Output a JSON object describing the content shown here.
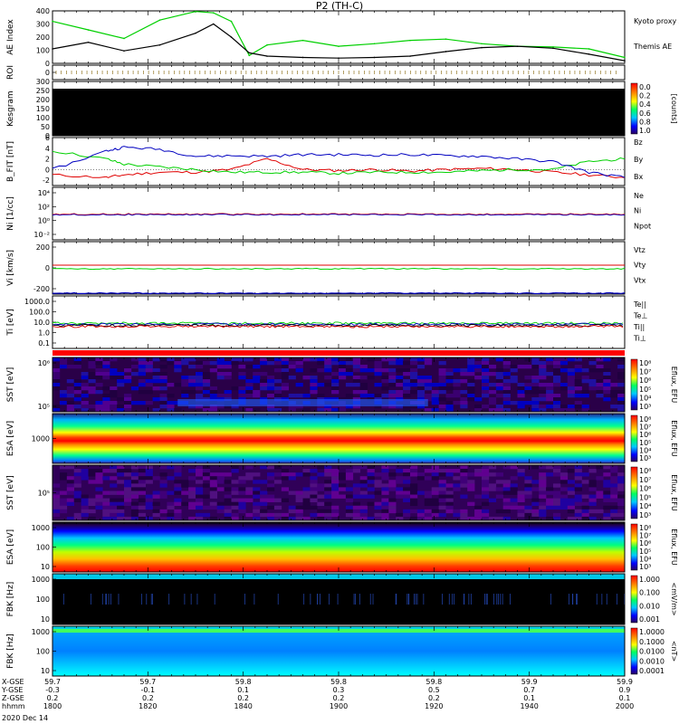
{
  "title": "P2 (TH-C)",
  "colors": {
    "green": "#00d000",
    "red": "#e00000",
    "blue": "#0000c0",
    "black": "#000000",
    "magenta": "#c000c0",
    "cyan": "#00c8c8"
  },
  "time_axis": {
    "tick_values": [
      "1800",
      "1820",
      "1840",
      "1900",
      "1920",
      "1940",
      "2000"
    ],
    "rows": [
      {
        "label": "X-GSE",
        "values": [
          "59.7",
          "59.7",
          "59.8",
          "59.8",
          "59.8",
          "59.9",
          "59.9"
        ]
      },
      {
        "label": "Y-GSE",
        "values": [
          "-0.3",
          "-0.1",
          "0.1",
          "0.3",
          "0.5",
          "0.7",
          "0.9"
        ]
      },
      {
        "label": "Z-GSE",
        "values": [
          "0.2",
          "0.2",
          "0.2",
          "0.2",
          "0.2",
          "0.1",
          "0.1"
        ]
      },
      {
        "label": "hhmm",
        "values": [
          "1800",
          "1820",
          "1840",
          "1900",
          "1920",
          "1940",
          "2000"
        ]
      }
    ],
    "date": "2020 Dec 14"
  },
  "chart_data": [
    {
      "type": "line",
      "ylabel": "AE Index",
      "ylim": [
        0,
        400
      ],
      "ytick_labels": [
        "0",
        "100",
        "200",
        "300",
        "400"
      ],
      "x": [
        1800,
        1810,
        1820,
        1830,
        1840,
        1845,
        1850,
        1855,
        1860,
        1870,
        1880,
        1890,
        1900,
        1910,
        1920,
        1930,
        1940,
        1950,
        1960
      ],
      "series": [
        {
          "name": "Kyoto proxy AE",
          "color_key": "green",
          "values": [
            320,
            255,
            190,
            330,
            395,
            385,
            320,
            60,
            140,
            175,
            130,
            150,
            175,
            185,
            150,
            130,
            125,
            110,
            45
          ]
        },
        {
          "name": "Themis AE",
          "color_key": "black",
          "values": [
            110,
            160,
            95,
            140,
            230,
            300,
            200,
            80,
            55,
            45,
            40,
            45,
            55,
            90,
            120,
            130,
            115,
            70,
            20
          ]
        }
      ]
    },
    {
      "type": "line",
      "ylabel": "ROI",
      "ytick_labels": [
        "0"
      ]
    },
    {
      "type": "heatmap",
      "ylabel": "Kesgram",
      "ylim": [
        0,
        300
      ],
      "ytick_labels": [
        "0",
        "50",
        "100",
        "150",
        "200",
        "250",
        "300"
      ],
      "colorbar": {
        "label": "[counts]",
        "tick_labels": [
          "0.0",
          "0.2",
          "0.4",
          "0.6",
          "0.8",
          "1.0"
        ]
      }
    },
    {
      "type": "line",
      "ylabel": "B_FIT [nT]",
      "ylim": [
        -3,
        6
      ],
      "ytick_labels": [
        "6",
        "4",
        "2",
        "0",
        "-2"
      ],
      "x": [
        1800,
        1815,
        1820,
        1830,
        1840,
        1850,
        1860,
        1870,
        1880,
        1890,
        1900,
        1910,
        1920,
        1930,
        1940,
        1950,
        1960
      ],
      "series": [
        {
          "name": "Bz",
          "color_key": "red",
          "values": [
            -1.0,
            -1.5,
            -1.0,
            -0.5,
            -0.5,
            0.0,
            2.0,
            0.0,
            -0.2,
            0.0,
            -0.3,
            0.0,
            0.2,
            0.0,
            -0.5,
            -1.0,
            -1.5
          ]
        },
        {
          "name": "By",
          "color_key": "green",
          "values": [
            3.5,
            2.0,
            1.0,
            0.5,
            0.0,
            -0.5,
            -0.5,
            -0.5,
            -0.7,
            -0.5,
            -0.5,
            -0.5,
            -0.2,
            0.0,
            0.0,
            1.5,
            2.0
          ]
        },
        {
          "name": "Bx",
          "color_key": "blue",
          "values": [
            0.0,
            3.5,
            4.2,
            3.8,
            2.5,
            2.6,
            2.5,
            2.8,
            2.8,
            2.7,
            2.8,
            2.6,
            2.5,
            2.0,
            1.5,
            -0.5,
            -1.5
          ]
        }
      ]
    },
    {
      "type": "line",
      "ylabel": "Ni [1/cc]",
      "ytick_labels": [
        "10⁴",
        "10²",
        "10⁰",
        "10⁻²"
      ],
      "series": [
        {
          "name": "Ne",
          "color_key": "red"
        },
        {
          "name": "Ni",
          "color_key": "black"
        },
        {
          "name": "Npot",
          "color_key": "blue"
        }
      ]
    },
    {
      "type": "line",
      "ylabel": "Vi [km/s]",
      "ytick_labels": [
        "200",
        "0",
        "-200"
      ],
      "series": [
        {
          "name": "Vtz",
          "color_key": "red"
        },
        {
          "name": "Vty",
          "color_key": "green"
        },
        {
          "name": "Vtx",
          "color_key": "blue"
        }
      ]
    },
    {
      "type": "line",
      "ylabel": "Ti [eV]",
      "ytick_labels": [
        "1000.0",
        "100.0",
        "10.0",
        "1.0",
        "0.1"
      ],
      "series": [
        {
          "name": "Te||",
          "color_key": "black"
        },
        {
          "name": "Te⊥",
          "color_key": "red"
        },
        {
          "name": "Ti||",
          "color_key": "green"
        },
        {
          "name": "Ti⊥",
          "color_key": "blue"
        }
      ]
    },
    {
      "type": "heatmap",
      "ylabel": "SST [eV]",
      "ytick_labels": [
        "10⁶",
        "10⁵"
      ],
      "colorbar": {
        "label": "Eflux, EFU",
        "tick_labels": [
          "10⁸",
          "10⁷",
          "10⁶",
          "10⁵",
          "10⁴",
          "10³"
        ]
      }
    },
    {
      "type": "heatmap",
      "ylabel": "ESA [eV]",
      "ytick_labels": [
        "1000"
      ],
      "colorbar": {
        "label": "Eflux, EFU",
        "tick_labels": [
          "10⁸",
          "10⁷",
          "10⁶",
          "10⁵",
          "10⁴",
          "10³"
        ]
      }
    },
    {
      "type": "heatmap",
      "ylabel": "SST [eV]",
      "ytick_labels": [
        "10⁵"
      ],
      "colorbar": {
        "label": "Eflux, EFU",
        "tick_labels": [
          "10⁸",
          "10⁷",
          "10⁶",
          "10⁵",
          "10⁴",
          "10³"
        ]
      }
    },
    {
      "type": "heatmap",
      "ylabel": "ESA [eV]",
      "ytick_labels": [
        "1000",
        "100",
        "10"
      ],
      "colorbar": {
        "label": "Eflux, EFU",
        "tick_labels": [
          "10⁸",
          "10⁷",
          "10⁶",
          "10⁵",
          "10⁴",
          "10³"
        ]
      }
    },
    {
      "type": "heatmap",
      "ylabel": "FBK [Hz]",
      "ytick_labels": [
        "1000",
        "100",
        "10"
      ],
      "colorbar": {
        "label": "<mV/m>",
        "tick_labels": [
          "1.000",
          "0.100",
          "0.010",
          "0.001"
        ]
      }
    },
    {
      "type": "heatmap",
      "ylabel": "FBK [Hz]",
      "ytick_labels": [
        "1000",
        "100",
        "10"
      ],
      "colorbar": {
        "label": "<nT>",
        "tick_labels": [
          "1.0000",
          "0.1000",
          "0.0100",
          "0.0010",
          "0.0001"
        ]
      }
    }
  ]
}
